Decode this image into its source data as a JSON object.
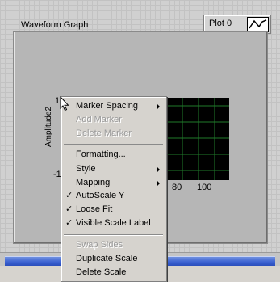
{
  "graph": {
    "title": "Waveform Graph",
    "y_axis_label": "Amplitude2",
    "y_ticks": [
      "10",
      "-1"
    ],
    "x_ticks": [
      "80",
      "100"
    ]
  },
  "legend": {
    "plot_label": "Plot 0"
  },
  "context_menu": {
    "items": [
      {
        "label": "Marker Spacing",
        "submenu": true,
        "disabled": false,
        "checked": false
      },
      {
        "label": "Add Marker",
        "submenu": false,
        "disabled": true,
        "checked": false
      },
      {
        "label": "Delete Marker",
        "submenu": false,
        "disabled": true,
        "checked": false
      },
      {
        "label": "Formatting...",
        "submenu": false,
        "disabled": false,
        "checked": false
      },
      {
        "label": "Style",
        "submenu": true,
        "disabled": false,
        "checked": false
      },
      {
        "label": "Mapping",
        "submenu": true,
        "disabled": false,
        "checked": false
      },
      {
        "label": "AutoScale Y",
        "submenu": false,
        "disabled": false,
        "checked": true
      },
      {
        "label": "Loose Fit",
        "submenu": false,
        "disabled": false,
        "checked": true
      },
      {
        "label": "Visible Scale Label",
        "submenu": false,
        "disabled": false,
        "checked": true
      },
      {
        "label": "Swap Sides",
        "submenu": false,
        "disabled": true,
        "checked": false
      },
      {
        "label": "Duplicate Scale",
        "submenu": false,
        "disabled": false,
        "checked": false
      },
      {
        "label": "Delete Scale",
        "submenu": false,
        "disabled": false,
        "checked": false
      }
    ],
    "check_glyph": "✓"
  },
  "colors": {
    "plot_background": "#000000",
    "plot_grid": "#1f7a2a",
    "menu_background": "#d6d3ce",
    "disabled_text": "#9a9a9a",
    "scrollbar_blue": "#3a60d0"
  }
}
